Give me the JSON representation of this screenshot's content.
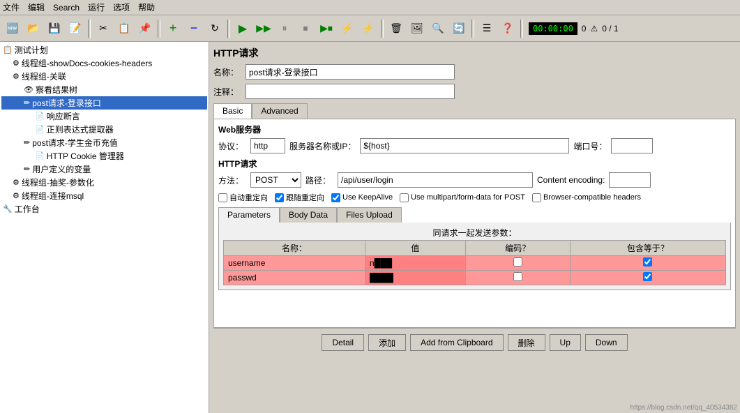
{
  "menubar": {
    "items": [
      "文件",
      "编辑",
      "Search",
      "运行",
      "选项",
      "帮助"
    ]
  },
  "toolbar": {
    "timer": "00:00:00",
    "errors": "0",
    "progress": "0 / 1"
  },
  "sidebar": {
    "tree": [
      {
        "id": "plan",
        "label": "测试计划",
        "level": 0,
        "icon": "📋",
        "expand": true
      },
      {
        "id": "thread1",
        "label": "线程组-showDocs-cookies-headers",
        "level": 1,
        "icon": "⚙",
        "expand": false
      },
      {
        "id": "thread2",
        "label": "线程组-关联",
        "level": 1,
        "icon": "⚙",
        "expand": false
      },
      {
        "id": "view",
        "label": "察看结果树",
        "level": 2,
        "icon": "👁"
      },
      {
        "id": "post1",
        "label": "post请求-登录接口",
        "level": 2,
        "icon": "✏",
        "selected": true
      },
      {
        "id": "resp",
        "label": "响应断言",
        "level": 3,
        "icon": "📄"
      },
      {
        "id": "regex",
        "label": "正则表达式提取器",
        "level": 3,
        "icon": "📄"
      },
      {
        "id": "post2",
        "label": "post请求-学生金币充值",
        "level": 2,
        "icon": "✏"
      },
      {
        "id": "cookie",
        "label": "HTTP Cookie 管理器",
        "level": 3,
        "icon": "📄"
      },
      {
        "id": "var",
        "label": "用户定义的变量",
        "level": 2,
        "icon": "✏"
      },
      {
        "id": "thread3",
        "label": "线程组-抽奖-参数化",
        "level": 1,
        "icon": "⚙"
      },
      {
        "id": "thread4",
        "label": "线程组-连接msql",
        "level": 1,
        "icon": "⚙"
      },
      {
        "id": "workbench",
        "label": "工作台",
        "level": 0,
        "icon": "🔧"
      }
    ]
  },
  "main": {
    "section_title": "HTTP请求",
    "name_label": "名称：",
    "name_value": "post请求-登录接口",
    "comment_label": "注释：",
    "comment_value": "",
    "tabs": [
      "Basic",
      "Advanced"
    ],
    "active_tab": "Basic",
    "web_server": {
      "title": "Web服务器",
      "protocol_label": "协议：",
      "protocol_value": "http",
      "server_label": "服务器名称或IP：",
      "server_value": "${host}",
      "port_label": "端口号：",
      "port_value": ""
    },
    "http_request": {
      "title": "HTTP请求",
      "method_label": "方法：",
      "method_value": "POST",
      "path_label": "路径：",
      "path_value": "/api/user/login",
      "encoding_label": "Content encoding:",
      "encoding_value": ""
    },
    "checkboxes": [
      {
        "label": "自动重定向",
        "checked": false
      },
      {
        "label": "跟随重定向",
        "checked": true
      },
      {
        "label": "Use KeepAlive",
        "checked": true
      },
      {
        "label": "Use multipart/form-data for POST",
        "checked": false
      },
      {
        "label": "Browser-compatible headers",
        "checked": false
      }
    ],
    "inner_tabs": [
      "Parameters",
      "Body Data",
      "Files Upload"
    ],
    "active_inner_tab": "Parameters",
    "params_header": "同请求一起发送参数：",
    "table": {
      "columns": [
        "名称：",
        "值",
        "编码？",
        "包含等于？"
      ],
      "rows": [
        {
          "name": "username",
          "value": "n...",
          "encode": true,
          "include_equals": true,
          "redacted": true
        },
        {
          "name": "passwd",
          "value": "...",
          "encode": false,
          "include_equals": true,
          "redacted": true
        }
      ]
    },
    "buttons": [
      "Detail",
      "添加",
      "Add from Clipboard",
      "删除",
      "Up",
      "Down"
    ]
  }
}
